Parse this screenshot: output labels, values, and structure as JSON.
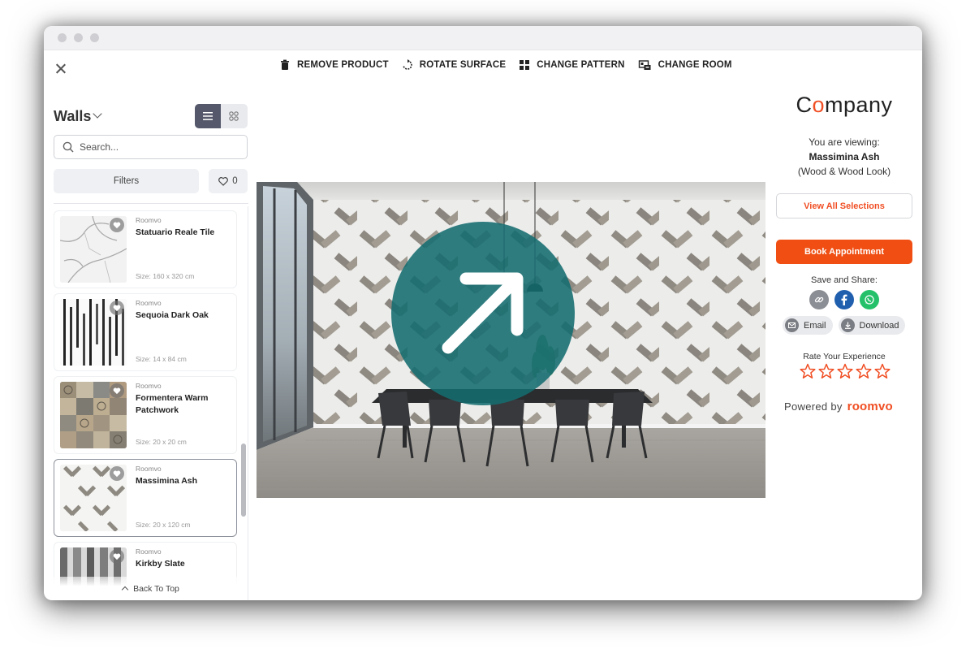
{
  "toolbar": {
    "tools": [
      {
        "label": "REMOVE PRODUCT",
        "icon": "trash-icon"
      },
      {
        "label": "ROTATE SURFACE",
        "icon": "rotate-icon"
      },
      {
        "label": "CHANGE PATTERN",
        "icon": "pattern-grid-icon"
      },
      {
        "label": "CHANGE ROOM",
        "icon": "room-icon"
      }
    ]
  },
  "sidebar": {
    "surface_title": "Walls",
    "search_placeholder": "Search...",
    "filters_label": "Filters",
    "favorites_count": "0",
    "back_to_top": "Back To Top",
    "products": [
      {
        "brand": "Roomvo",
        "name": "Statuario Reale Tile",
        "size": "Size: 160 x 320 cm",
        "thumb": "marble"
      },
      {
        "brand": "Roomvo",
        "name": "Sequoia Dark Oak",
        "size": "Size: 14 x 84 cm",
        "thumb": "stripes"
      },
      {
        "brand": "Roomvo",
        "name": "Formentera Warm Patchwork",
        "size": "Size: 20 x 20 cm",
        "thumb": "patchwork"
      },
      {
        "brand": "Roomvo",
        "name": "Massimina Ash",
        "size": "Size: 20 x 120 cm",
        "thumb": "herringbone",
        "selected": true
      },
      {
        "brand": "Roomvo",
        "name": "Kirkby Slate",
        "size": "",
        "thumb": "slate"
      }
    ]
  },
  "panel": {
    "logo_before": "C",
    "logo_accent": "o",
    "logo_after": "mpany",
    "viewing_label": "You are viewing:",
    "product_name": "Massimina Ash",
    "product_category": "(Wood & Wood Look)",
    "view_all_label": "View All Selections",
    "book_label": "Book Appointment",
    "share_label": "Save and Share:",
    "email_label": "Email",
    "download_label": "Download",
    "rate_label": "Rate Your Experience",
    "powered_label": "Powered by",
    "powered_brand": "roomvo"
  },
  "colors": {
    "accent": "#f04e23",
    "overlay": "#146c70",
    "facebook": "#1f5fae",
    "whatsapp": "#25c06a"
  }
}
